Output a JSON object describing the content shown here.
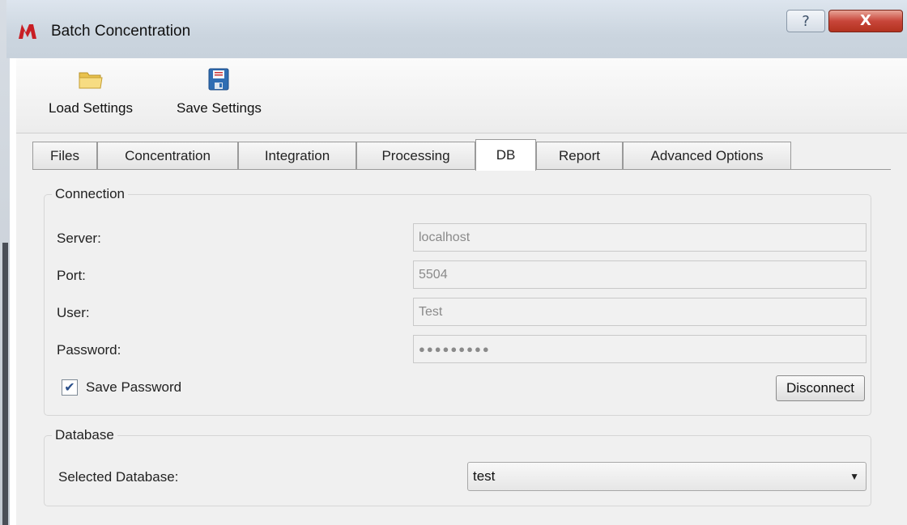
{
  "window": {
    "title": "Batch Concentration",
    "help_glyph": "?",
    "close_glyph": "X"
  },
  "toolbar": {
    "load_label": "Load Settings",
    "save_label": "Save Settings",
    "load_icon": "folder-icon",
    "save_icon": "floppy-disk-icon"
  },
  "tabs": [
    {
      "label": "Files",
      "active": false
    },
    {
      "label": "Concentration",
      "active": false
    },
    {
      "label": "Integration",
      "active": false
    },
    {
      "label": "Processing",
      "active": false
    },
    {
      "label": "DB",
      "active": true
    },
    {
      "label": "Report",
      "active": false
    },
    {
      "label": "Advanced Options",
      "active": false
    }
  ],
  "connection": {
    "title": "Connection",
    "server_label": "Server:",
    "server_value": "localhost",
    "port_label": "Port:",
    "port_value": "5504",
    "user_label": "User:",
    "user_value": "Test",
    "password_label": "Password:",
    "password_value": "●●●●●●●●●",
    "save_password_label": "Save Password",
    "save_password_checked": true,
    "disconnect_label": "Disconnect"
  },
  "database": {
    "title": "Database",
    "selected_label": "Selected Database:",
    "selected_value": "test"
  },
  "colors": {
    "close_button": "#c8463a",
    "save_icon_blue": "#2f6db3",
    "folder_yellow": "#f3d36b"
  }
}
